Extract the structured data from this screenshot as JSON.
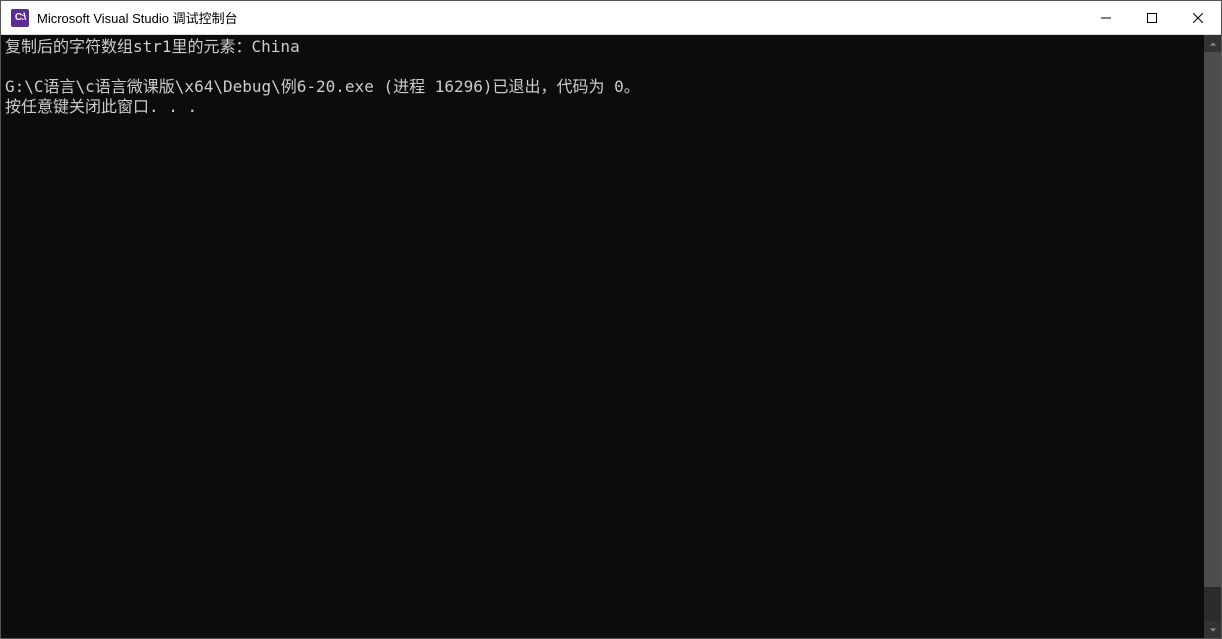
{
  "titlebar": {
    "icon_text": "C:\\",
    "title": "Microsoft Visual Studio 调试控制台"
  },
  "console": {
    "lines": [
      "复制后的字符数组str1里的元素：China",
      "",
      "G:\\C语言\\c语言微课版\\x64\\Debug\\例6-20.exe (进程 16296)已退出，代码为 0。",
      "按任意键关闭此窗口. . ."
    ]
  },
  "scrollbar": {
    "thumb_top_pct": 0,
    "thumb_height_pct": 94
  }
}
